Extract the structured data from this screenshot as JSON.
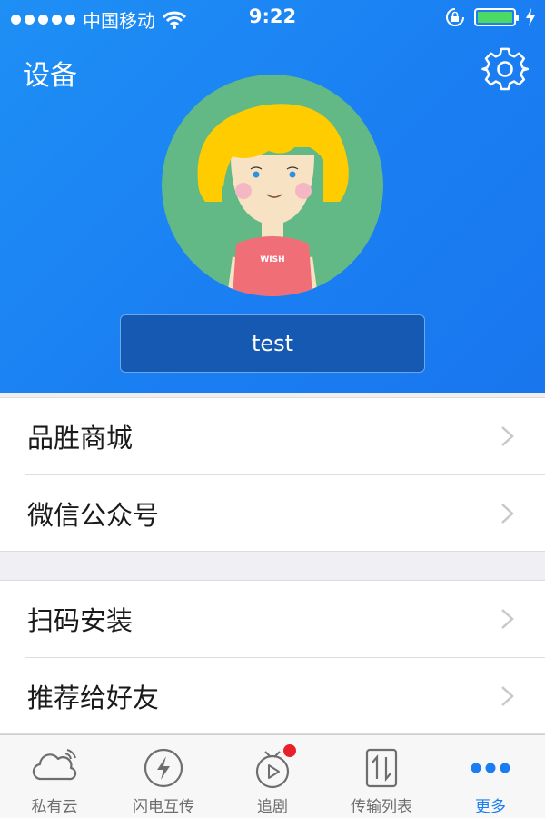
{
  "status": {
    "carrier": "中国移动",
    "time": "9:22"
  },
  "header": {
    "title": "设备",
    "shirt_text": "WISH",
    "username": "test"
  },
  "menu": {
    "group1": [
      "品胜商城",
      "微信公众号"
    ],
    "group2": [
      "扫码安装",
      "推荐给好友"
    ]
  },
  "tabs": [
    {
      "label": "私有云",
      "icon": "cloud-icon"
    },
    {
      "label": "闪电互传",
      "icon": "lightning-icon"
    },
    {
      "label": "追剧",
      "icon": "tv-play-icon"
    },
    {
      "label": "传输列表",
      "icon": "transfer-list-icon"
    },
    {
      "label": "更多",
      "icon": "more-dots-icon"
    }
  ],
  "colors": {
    "header_bg": "#1e8ff5",
    "accent": "#1a7ef2",
    "badge": "#e8202a"
  }
}
